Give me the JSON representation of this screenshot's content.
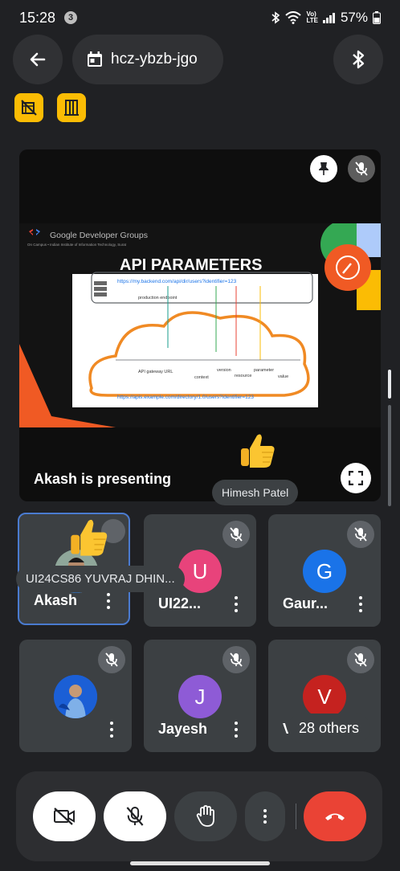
{
  "status_bar": {
    "time": "15:28",
    "notification_count": "3",
    "battery": "57%"
  },
  "header": {
    "meeting_code": "hcz-ybzb-jgo"
  },
  "presentation": {
    "presenting_text": "Akash is presenting",
    "reaction_name": "Himesh Patel",
    "slide": {
      "org_title": "Google Developer Groups",
      "org_subtitle": "On Campus • Indian Institute of Information Technology, Surat",
      "heading": "API PARAMETERS",
      "url_top": "https://my.backend.com/api/dir/users?identifier=123",
      "label_production": "production endpoint",
      "label_gateway": "API gateway URL",
      "label_context": "context",
      "label_version": "version",
      "label_resource": "resource",
      "label_parameter": "parameter",
      "label_value": "value",
      "url_bottom": "https://apis.example.com/directory/1.0/users?identifier=123"
    }
  },
  "participants": [
    {
      "name": "Akash",
      "initial": "",
      "color": "#3c4043",
      "muted": false,
      "active": true
    },
    {
      "name": "UI22...",
      "initial": "U",
      "color": "#e8437b",
      "muted": true,
      "active": false
    },
    {
      "name": "Gaur...",
      "initial": "G",
      "color": "#1a73e8",
      "muted": true,
      "active": false
    },
    {
      "name": "",
      "initial": "",
      "color": "#1a5fd1",
      "muted": true,
      "active": false
    },
    {
      "name": "Jayesh",
      "initial": "J",
      "color": "#8e5bd6",
      "muted": true,
      "active": false
    },
    {
      "name": "Ve",
      "initial": "V",
      "color": "#c5221f",
      "muted": true,
      "active": false
    }
  ],
  "name_tooltip": "UI24CS86 YUVRAJ DHIN...",
  "others_label": "28 others",
  "colors": {
    "background": "#202124",
    "tile": "#3c4043",
    "end_call": "#ea4335",
    "badge": "#fbbc04"
  },
  "icons": [
    "back-arrow-icon",
    "calendar-icon",
    "bluetooth-icon",
    "no-video-badge-icon",
    "door-badge-icon",
    "pin-icon",
    "mic-off-icon",
    "fullscreen-icon",
    "thumbs-up-icon",
    "camera-off-icon",
    "raise-hand-icon",
    "more-vert-icon",
    "end-call-icon"
  ]
}
